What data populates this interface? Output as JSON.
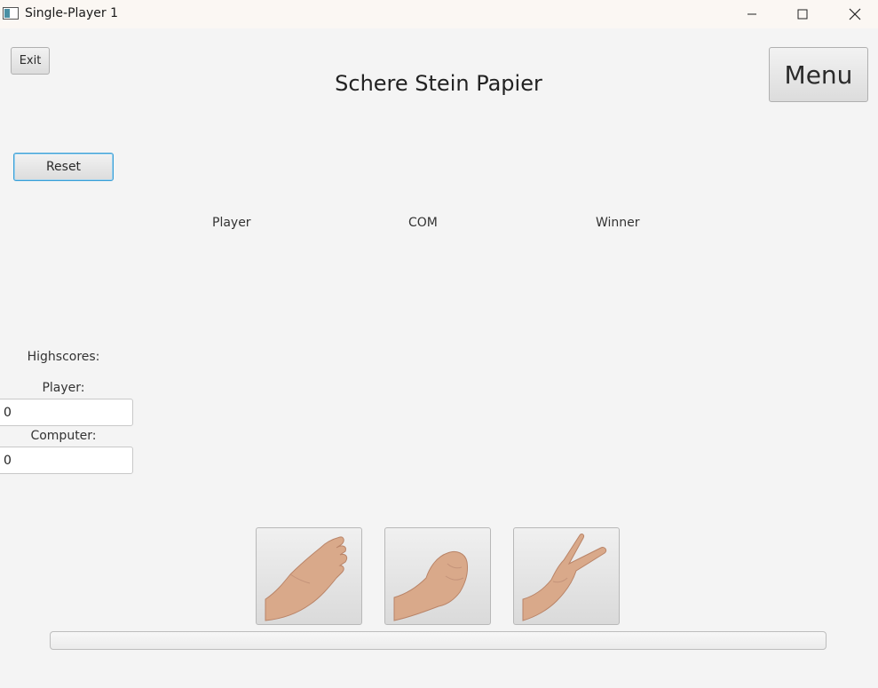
{
  "window": {
    "title": "Single-Player 1",
    "icons": [
      "app-icon",
      "minimize-icon",
      "maximize-icon",
      "close-icon"
    ]
  },
  "header": {
    "exit_label": "Exit",
    "title": "Schere Stein Papier",
    "menu_label": "Menu"
  },
  "controls": {
    "reset_label": "Reset"
  },
  "columns": {
    "player": "Player",
    "com": "COM",
    "winner": "Winner"
  },
  "highscores": {
    "title": "Highscores:",
    "player_label": "Player:",
    "player_value": "0",
    "computer_label": "Computer:",
    "computer_value": "0"
  },
  "choices": [
    {
      "name": "paper",
      "icon": "paper-hand-icon"
    },
    {
      "name": "rock",
      "icon": "rock-fist-icon"
    },
    {
      "name": "scissors",
      "icon": "scissors-hand-icon"
    }
  ],
  "progress": {
    "value": 0
  },
  "colors": {
    "accent": "#3a9fd6",
    "background": "#f4f4f4",
    "skin": "#d9a98a"
  }
}
